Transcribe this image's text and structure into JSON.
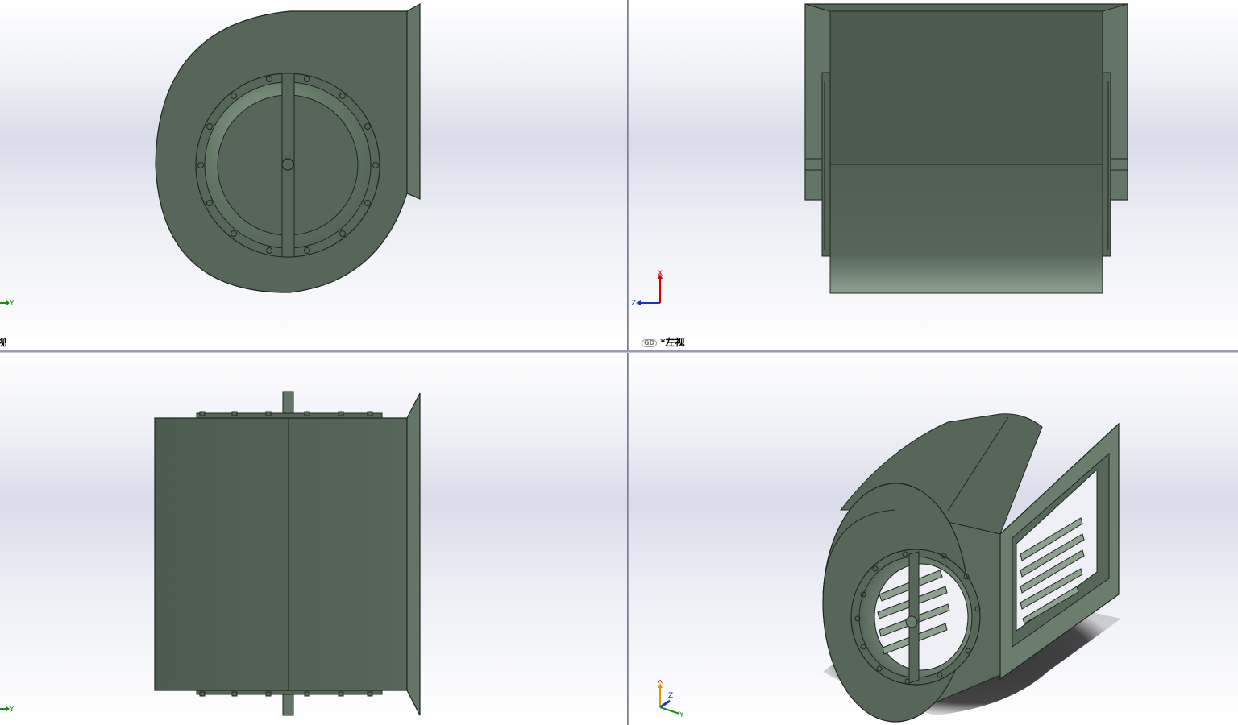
{
  "colors": {
    "body": "#56675a",
    "body_dark": "#4a5a4d",
    "body_light": "#8ea190",
    "edge": "#1e261f",
    "background_top": "#ffffff",
    "background_mid": "#d9dce8",
    "divider": "#9a9cb4",
    "axis_x": "#d40000",
    "axis_y": "#1a8a1a",
    "axis_z": "#1a2fd0"
  },
  "viewports": {
    "top_left": {
      "label": "视"
    },
    "top_right": {
      "label": "*左视"
    },
    "bottom_left": {
      "label": ""
    },
    "bottom_right": {
      "label": ""
    }
  },
  "triad": {
    "x": "X",
    "y": "Y",
    "z": "Z"
  }
}
